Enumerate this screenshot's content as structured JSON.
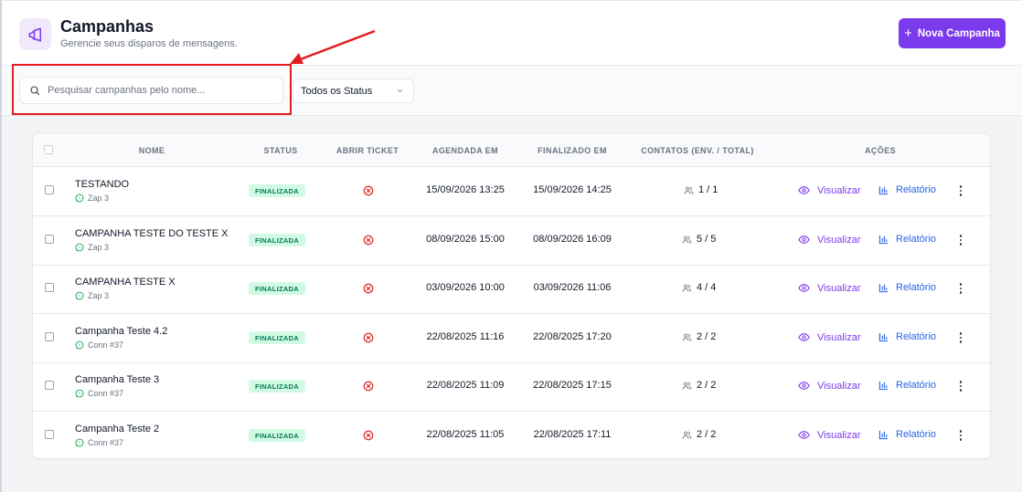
{
  "header": {
    "title": "Campanhas",
    "subtitle": "Gerencie seus disparos de mensagens.",
    "new_button_label": "Nova Campanha",
    "icon": "megaphone-icon",
    "accent_color": "#7c3aed"
  },
  "filters": {
    "search_placeholder": "Pesquisar campanhas pelo nome...",
    "search_value": "",
    "status_selected": "Todos os Status"
  },
  "table": {
    "columns": {
      "nome": "NOME",
      "status": "STATUS",
      "abrir_ticket": "ABRIR TICKET",
      "agendada": "AGENDADA EM",
      "finalizado": "FINALIZADO EM",
      "contatos": "CONTATOS (ENV. / TOTAL)",
      "acoes": "AÇÕES"
    },
    "action_view_label": "Visualizar",
    "action_report_label": "Relatório",
    "rows": [
      {
        "name": "TESTANDO",
        "connection": "Zap 3",
        "status": "FINALIZADA",
        "scheduled": "15/09/2026 13:25",
        "finished": "15/09/2026 14:25",
        "contacts": "1 / 1"
      },
      {
        "name": "CAMPANHA TESTE DO TESTE X",
        "connection": "Zap 3",
        "status": "FINALIZADA",
        "scheduled": "08/09/2026 15:00",
        "finished": "08/09/2026 16:09",
        "contacts": "5 / 5"
      },
      {
        "name": "CAMPANHA TESTE X",
        "connection": "Zap 3",
        "status": "FINALIZADA",
        "scheduled": "03/09/2026 10:00",
        "finished": "03/09/2026 11:06",
        "contacts": "4 / 4"
      },
      {
        "name": "Campanha Teste 4.2",
        "connection": "Conn #37",
        "status": "FINALIZADA",
        "scheduled": "22/08/2025 11:16",
        "finished": "22/08/2025 17:20",
        "contacts": "2 / 2"
      },
      {
        "name": "Campanha Teste 3",
        "connection": "Conn #37",
        "status": "FINALIZADA",
        "scheduled": "22/08/2025 11:09",
        "finished": "22/08/2025 17:15",
        "contacts": "2 / 2"
      },
      {
        "name": "Campanha Teste 2",
        "connection": "Conn #37",
        "status": "FINALIZADA",
        "scheduled": "22/08/2025 11:05",
        "finished": "22/08/2025 17:11",
        "contacts": "2 / 2"
      }
    ]
  },
  "colors": {
    "status_badge_bg": "#d1fae5",
    "status_badge_text": "#047857",
    "ticket_icon": "#dc2626",
    "view_link": "#7c3aed",
    "report_link": "#2563eb",
    "annotation": "#e11d1d"
  }
}
